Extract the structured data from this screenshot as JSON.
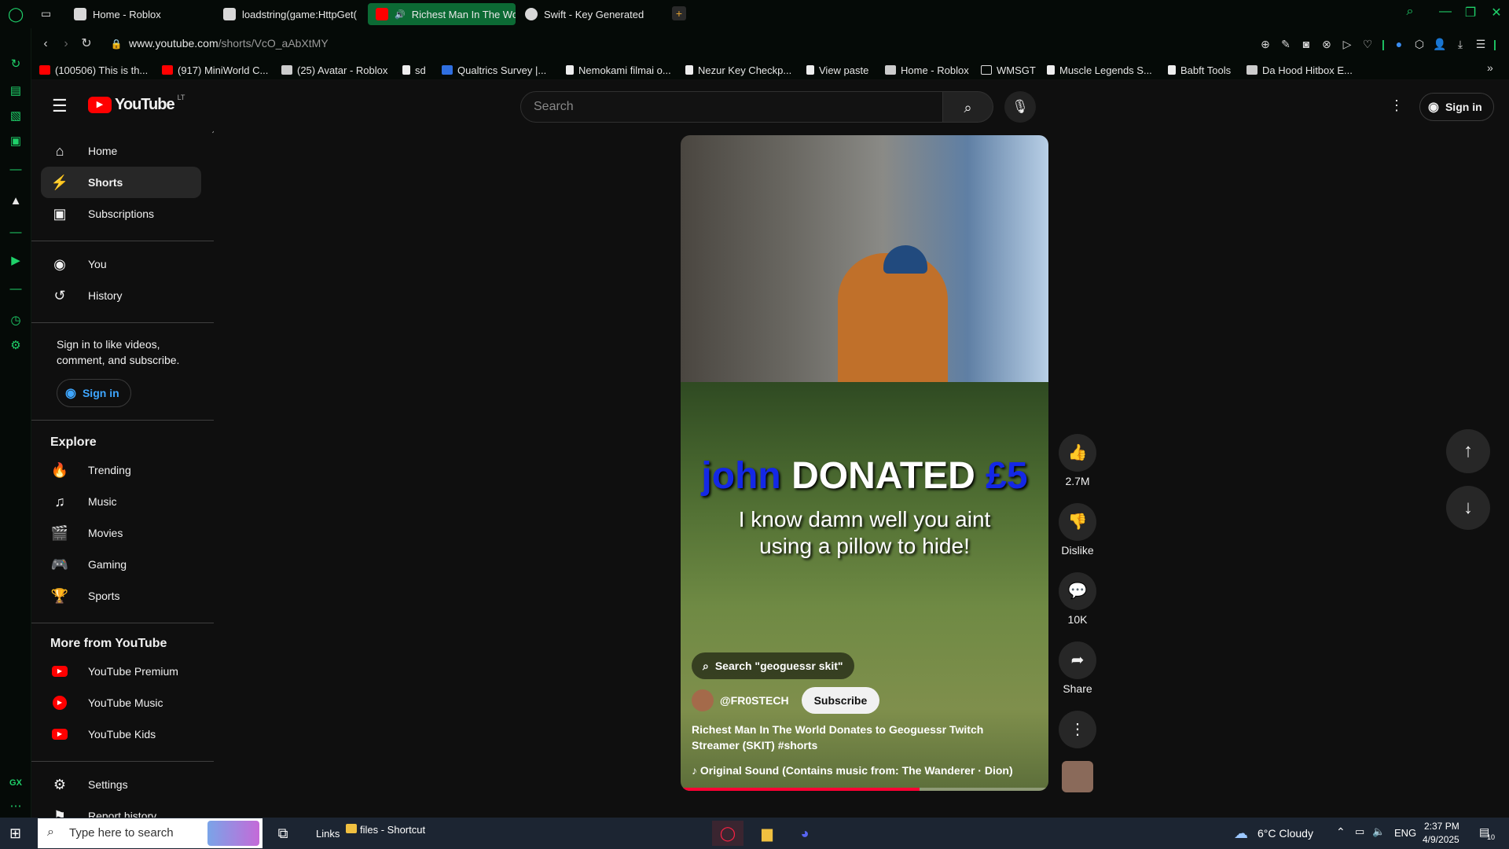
{
  "tabs": [
    {
      "label": "Home - Roblox",
      "favicon_color": "#d8d8d8"
    },
    {
      "label": "loadstring(game:HttpGet(",
      "favicon_color": "#d8d8d8"
    },
    {
      "label": "Richest Man In The Wo",
      "favicon_color": "#ff0000",
      "active": true
    },
    {
      "label": "Swift - Key Generated",
      "favicon_color": "#d8d8d8"
    }
  ],
  "new_tab_label": "+",
  "address": {
    "url_host": "www.youtube.com",
    "url_path": "/shorts/VcO_aAbXtMY"
  },
  "bookmarks": [
    {
      "label": "(100506) This is th...",
      "color": "#ff0000"
    },
    {
      "label": "(917) MiniWorld C...",
      "color": "#ff0000"
    },
    {
      "label": "(25) Avatar - Roblox",
      "color": "#cccccc"
    },
    {
      "label": "sd",
      "color": "#eeeeee"
    },
    {
      "label": "Qualtrics Survey |...",
      "color": "#2f6fe0"
    },
    {
      "label": "Nemokami filmai o...",
      "color": "#eeeeee"
    },
    {
      "label": "Nezur Key Checkp...",
      "color": "#eeeeee"
    },
    {
      "label": "View paste",
      "color": "#eeeeee"
    },
    {
      "label": "Home - Roblox",
      "color": "#cccccc"
    },
    {
      "label": "WMSGT",
      "color": "#dddddd"
    },
    {
      "label": "Muscle Legends S...",
      "color": "#eeeeee"
    },
    {
      "label": "Babft Tools",
      "color": "#eeeeee"
    },
    {
      "label": "Da Hood Hitbox E...",
      "color": "#cccccc"
    }
  ],
  "header": {
    "logo_text": "YouTube",
    "logo_region": "LT",
    "search_placeholder": "Search",
    "sign_in": "Sign in"
  },
  "sidebar": {
    "main": [
      {
        "label": "Home",
        "icon": "home-icon"
      },
      {
        "label": "Shorts",
        "icon": "shorts-icon",
        "active": true
      },
      {
        "label": "Subscriptions",
        "icon": "subscriptions-icon"
      }
    ],
    "you": [
      {
        "label": "You",
        "icon": "you-icon"
      },
      {
        "label": "History",
        "icon": "history-icon"
      }
    ],
    "signin_prompt": "Sign in to like videos, comment, and subscribe.",
    "signin_button": "Sign in",
    "explore_title": "Explore",
    "explore": [
      {
        "label": "Trending",
        "icon": "trending-icon"
      },
      {
        "label": "Music",
        "icon": "music-icon"
      },
      {
        "label": "Movies",
        "icon": "movies-icon"
      },
      {
        "label": "Gaming",
        "icon": "gaming-icon"
      },
      {
        "label": "Sports",
        "icon": "sports-icon"
      }
    ],
    "more_title": "More from YouTube",
    "more": [
      {
        "label": "YouTube Premium"
      },
      {
        "label": "YouTube Music"
      },
      {
        "label": "YouTube Kids"
      }
    ],
    "settings": [
      {
        "label": "Settings",
        "icon": "settings-icon"
      },
      {
        "label": "Report history",
        "icon": "flag-icon"
      }
    ]
  },
  "short": {
    "caption_name": "john",
    "caption_donated": "DONATED",
    "caption_amount": "£5",
    "caption_line2": "I know damn well you aint using a pillow to hide!",
    "search_chip": "Search \"geoguessr skit\"",
    "channel": "@FR0STECH",
    "subscribe": "Subscribe",
    "title": "Richest Man In The World Donates to Geoguessr Twitch Streamer (SKIT)",
    "hashtag": "#shorts",
    "sound": "Original Sound (Contains music from: The Wanderer · Dion)",
    "progress": 0.65
  },
  "actions": {
    "likes": "2.7M",
    "dislike": "Dislike",
    "comments": "10K",
    "share": "Share"
  },
  "taskbar": {
    "search_placeholder": "Type here to search",
    "links": "Links",
    "files": "files - Shortcut",
    "weather": "6°C  Cloudy",
    "lang": "ENG",
    "time": "2:37 PM",
    "date": "4/9/2025",
    "notif_count": "10"
  }
}
